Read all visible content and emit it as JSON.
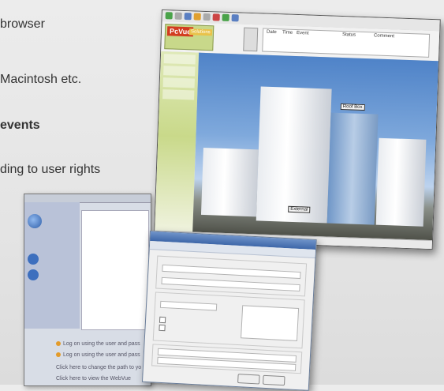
{
  "background_text": {
    "line1": "browser",
    "line2": "Macintosh etc.",
    "line3": "events",
    "line4": "ding to user rights"
  },
  "big_window": {
    "logo": "PcVue",
    "logo_sub": "Solutions",
    "header_columns": [
      "Date",
      "Time",
      "Event",
      "Status",
      "Comment"
    ],
    "labels": {
      "top": "Roof Box",
      "bottom": "External"
    }
  },
  "back_window": {
    "info_lines": [
      "Log on using the user and pass",
      "Log on using the user and pass",
      "Click here to change the path to yo",
      "Click here to view the WebVue"
    ]
  },
  "colors": {
    "accent_orange": "#e39b2a",
    "logo_red": "#d23b1f",
    "side_green": "#c9d98a"
  }
}
